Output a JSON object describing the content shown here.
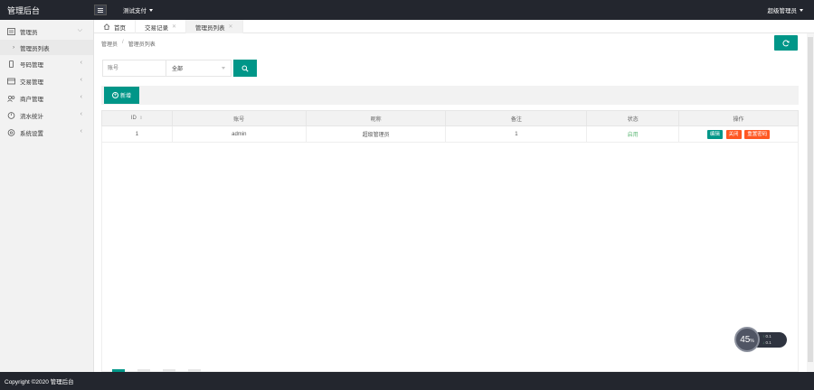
{
  "header": {
    "logo": "管理后台",
    "project": "测试支付",
    "user": "超级管理员"
  },
  "sidebar": {
    "items": [
      {
        "label": "管理员",
        "icon": "admin-icon",
        "expanded": true
      },
      {
        "label": "号码管理",
        "icon": "phone-icon"
      },
      {
        "label": "交易管理",
        "icon": "trade-icon"
      },
      {
        "label": "商户管理",
        "icon": "merchant-icon"
      },
      {
        "label": "流水统计",
        "icon": "stats-icon"
      },
      {
        "label": "系统设置",
        "icon": "settings-icon"
      }
    ],
    "sub_item": "管理员列表"
  },
  "tabs": [
    {
      "label": "首页"
    },
    {
      "label": "交易记录"
    },
    {
      "label": "管理员列表"
    }
  ],
  "breadcrumb": {
    "root": "管理员",
    "sep": "/",
    "current": "管理员列表"
  },
  "search": {
    "account_placeholder": "账号",
    "select_value": "全部"
  },
  "toolbar": {
    "add_label": "新增"
  },
  "table": {
    "columns": [
      "ID",
      "账号",
      "昵称",
      "备注",
      "状态",
      "操作"
    ],
    "rows": [
      {
        "id": "1",
        "account": "admin",
        "nickname": "超级管理员",
        "remark": "1",
        "status": "启用"
      }
    ],
    "actions": {
      "edit": "编辑",
      "disable": "关闭",
      "reset": "重置密码"
    }
  },
  "widget": {
    "percent": "45",
    "unit": "%",
    "up": "0.1",
    "down": "0.1"
  },
  "footer": {
    "copyright": "Copyright ©2020 管理后台"
  },
  "colors": {
    "primary": "#009688",
    "danger": "#ff5722",
    "header_bg": "#23262e"
  }
}
